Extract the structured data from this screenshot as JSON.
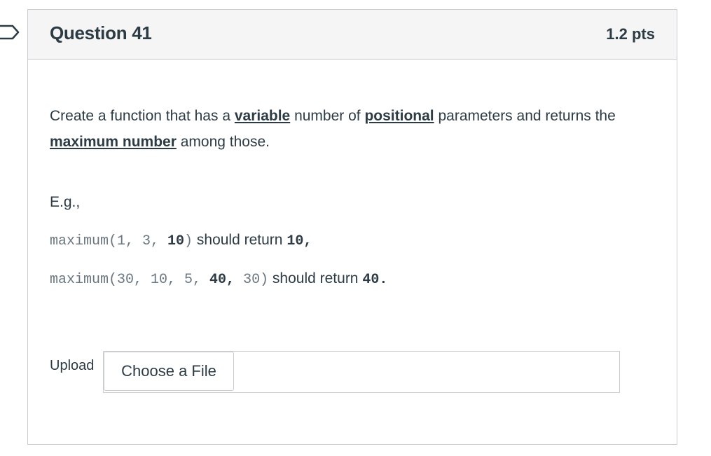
{
  "question": {
    "title": "Question 41",
    "points": "1.2 pts"
  },
  "prompt": {
    "t1": "Create a function that has a ",
    "b1": "variable",
    "t2": " number of ",
    "b2": "positional",
    "t3": " parameters and returns the ",
    "b3": "maximum number",
    "t4": " among those."
  },
  "example_label": "E.g.,",
  "examples": [
    {
      "call_prefix": "maximum(1, 3, ",
      "call_max": "10",
      "call_suffix": ")",
      "text": " should return ",
      "result": "10",
      "punct": ","
    },
    {
      "call_prefix": "maximum(30, 10, 5, ",
      "call_max": "40,",
      "call_suffix": " 30)",
      "text": " should return ",
      "result": "40",
      "punct": "."
    }
  ],
  "upload": {
    "label": "Upload",
    "button": "Choose a File"
  },
  "colors": {
    "text": "#2d3b45",
    "header_bg": "#f5f5f5",
    "border": "#c7cdd1"
  }
}
